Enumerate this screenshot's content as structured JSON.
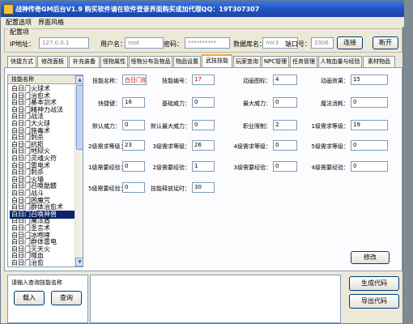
{
  "window": {
    "title": "战神传奇GM后台V1.9    购买软件请在软件登录界面购买或加代理QQ：19T307307"
  },
  "menu": {
    "items": [
      "配置选项",
      "界面风格"
    ]
  },
  "config": {
    "group_title": "配置项",
    "ip_label": "IP地址：",
    "ip_value": "127.0.0.1",
    "user_label": "用户名：",
    "user_value": "root",
    "pwd_label": "密码：",
    "pwd_value": "**********",
    "db_label": "数据库名：",
    "db_value": "mir3",
    "port_label": "端口号：",
    "port_value": "3306",
    "connect_btn": "连接",
    "disconnect_btn": "断开"
  },
  "tabs": [
    "快捷方式",
    "修改面板",
    "补充装备",
    "怪物属性",
    "怪物分布及物品",
    "物品设置",
    "武技技能",
    "玩家查询",
    "NPC管理",
    "任务管理",
    "人物血量与经验",
    "素材物品"
  ],
  "active_tab": "武技技能",
  "skill_list": {
    "header": "技能名称",
    "items": [
      "白日门火球术",
      "白日门治愈术",
      "白日门基本剑术",
      "白日门精神力战法",
      "白日门战法",
      "白日门大火球",
      "白日门施毒术",
      "白日门刺杀",
      "白日门抗拒",
      "白日门地狱火",
      "白日门灵魂火符",
      "白日门雷电术",
      "白日门刺杀",
      "白日门火墙",
      "白日门召唤骷髅",
      "白日门战斗",
      "白日门困魔咒",
      "白日门群体治愈术",
      "白日门召唤神兽",
      "白日门魔法盾",
      "白日门圣言术",
      "白日门冰咆哮",
      "白日门群体雷电",
      "白日门灭天火",
      "白日门噬血",
      "白日门治愈",
      "白日门火龙"
    ],
    "selected_index": 18
  },
  "skill_form": {
    "name_label": "技能名称：",
    "name_value": "白日门抬刚术",
    "id_label": "技能编号：",
    "id_value": "17",
    "anim_label": "动画图标：",
    "anim_value": "4",
    "effect_label": "动画效果：",
    "effect_value": "15",
    "shortcut_label": "快捷键：",
    "shortcut_value": "16",
    "base_label": "基础威力：",
    "base_value": "0",
    "maxpow_label": "最大威力：",
    "maxpow_value": "0",
    "mp_label": "魔法消耗：",
    "mp_value": "0",
    "defpow_label": "默认威力：",
    "defpow_value": "0",
    "defmax_label": "默认最大威力：",
    "defmax_value": "0",
    "job_label": "职业限制：",
    "job_value": "2",
    "l1req_label": "1级需求等级：",
    "l1req_value": "19",
    "l2req_label": "2级需求等级：",
    "l2req_value": "23",
    "l3req_label": "3级需求等级：",
    "l3req_value": "26",
    "l4req_label": "4级需求等级：",
    "l4req_value": "0",
    "l5req_label": "5级需求等级：",
    "l5req_value": "0",
    "l1exp_label": "1级需要经验：",
    "l1exp_value": "0",
    "l2exp_label": "2级需要经验：",
    "l2exp_value": "1",
    "l3exp_label": "3级需要经验：",
    "l3exp_value": "0",
    "l4exp_label": "4级需要经验：",
    "l4exp_value": "0",
    "l5exp_label": "5级需要经验：",
    "l5exp_value": "0",
    "delay_label": "技能释放延时：",
    "delay_value": "30",
    "modify_btn": "修改"
  },
  "bottom": {
    "search_placeholder": "请输入查询技能名称",
    "load_btn": "载入",
    "query_btn": "查询",
    "gen_btn": "生成代码",
    "export_btn": "导出代码"
  }
}
